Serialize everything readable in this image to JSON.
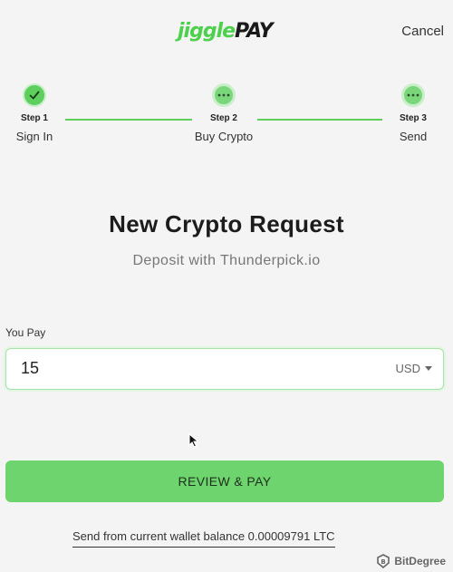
{
  "header": {
    "logo_part1": "jiggle",
    "logo_part2": "PAY",
    "cancel_label": "Cancel"
  },
  "stepper": {
    "steps": [
      {
        "number": "Step 1",
        "label": "Sign In",
        "status": "done"
      },
      {
        "number": "Step 2",
        "label": "Buy Crypto",
        "status": "current"
      },
      {
        "number": "Step 3",
        "label": "Send",
        "status": "pending"
      }
    ]
  },
  "main": {
    "title": "New Crypto Request",
    "subtitle": "Deposit with Thunderpick.io"
  },
  "payment": {
    "label": "You Pay",
    "amount": "15",
    "currency": "USD"
  },
  "actions": {
    "review_label": "REVIEW & PAY",
    "balance_link": "Send from current wallet balance 0.00009791 LTC"
  },
  "watermark": {
    "text": "BitDegree"
  },
  "colors": {
    "accent": "#5ccf5c",
    "button": "#6ed46e",
    "background": "#f4f4f4"
  }
}
